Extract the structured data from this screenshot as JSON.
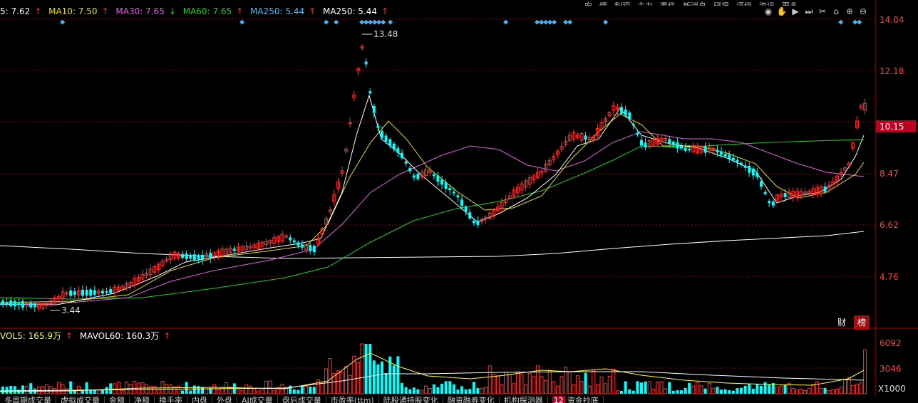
{
  "menu": {
    "items": [
      "安",
      "情",
      "利润",
      "主力",
      "事件",
      "新消息",
      "研报",
      "评级",
      "资讯",
      "更多"
    ]
  },
  "legend": {
    "ma5": {
      "text": "5: 7.62",
      "color": "#ffffff"
    },
    "ma10": {
      "text": "MA10: 7.50",
      "color": "#e8e000"
    },
    "ma30": {
      "text": "MA30: 7.65",
      "color": "#e060e0"
    },
    "ma60": {
      "text": "MA60: 7.65",
      "color": "#20d020"
    },
    "ma250a": {
      "text": "MA250: 5.44",
      "color": "#40c0ff"
    },
    "ma250b": {
      "text": "MA250: 5.44",
      "color": "#ffffff"
    }
  },
  "volume_legend": {
    "vol5": {
      "text": "VOL5: 165.9万",
      "color": "#ffff40"
    },
    "mavol60": {
      "text": "MAVOL60: 160.3万",
      "color": "#ffffff"
    }
  },
  "toolbar": {
    "icons": [
      "eye-icon",
      "hand-icon",
      "play-icon",
      "forward-icon",
      "scissors-icon",
      "home-icon",
      "zoom-in-icon",
      "zoom-out-icon"
    ]
  },
  "price_axis": {
    "labels": [
      "14.04",
      "12.18",
      "10.15",
      "8.47",
      "6.62",
      "4.76"
    ],
    "current": "10.15"
  },
  "volume_axis": {
    "labels": [
      "6092",
      "3046",
      "X1000"
    ]
  },
  "annotations": {
    "high": "13.48",
    "low": "3.44"
  },
  "badges": {
    "cai": "财",
    "bang": "榜"
  },
  "tabs": [
    "多周期成交量",
    "虚拟成交量",
    "金额",
    "净额",
    "换手率",
    "内盘",
    "外盘",
    "AI成交量",
    "盘后成交量",
    "市盈率(ttm)",
    "陆股通持股变化",
    "融资融券变化",
    "机构探测器",
    "资金抄底"
  ],
  "tab_number": "12",
  "colors": {
    "up": "#ff3030",
    "down": "#00ffff",
    "grid": "#8a0000",
    "axis_text": "#ff4040"
  }
}
